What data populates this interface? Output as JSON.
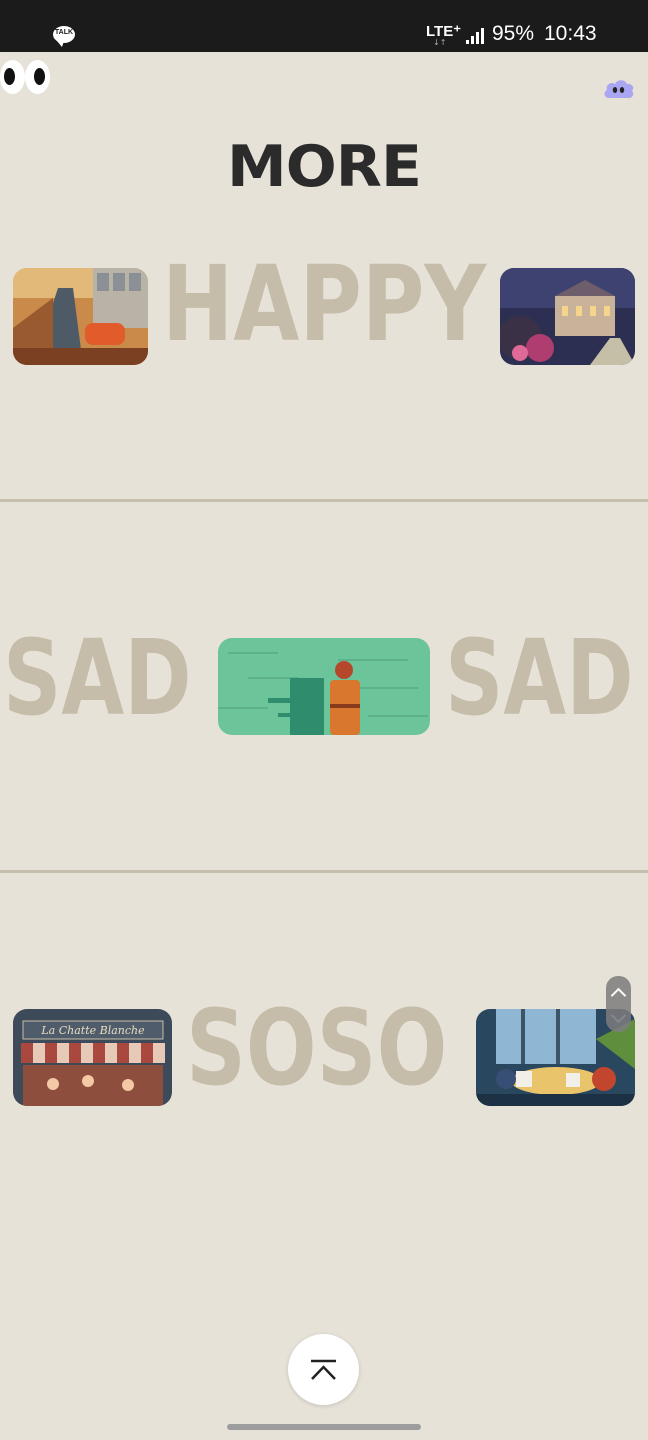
{
  "status_bar": {
    "app_badge": "TALK",
    "network": "LTE⁺",
    "battery": "95%",
    "time": "10:43"
  },
  "header": {
    "title": "MORE"
  },
  "sections": [
    {
      "word": "HAPPY",
      "images": [
        "rainy-street-illustration",
        "night-palace-garden-illustration"
      ]
    },
    {
      "word_left": "SAD",
      "word_right": "SAD",
      "images": [
        "woman-on-green-sea-illustration"
      ]
    },
    {
      "word": "SOSO",
      "images": [
        "la-chatte-blanche-shopfront-illustration",
        "cafe-window-illustration"
      ]
    }
  ],
  "shopfront_sign": "La Chatte Blanche",
  "colors": {
    "background": "#e7e2d8",
    "word": "#c5bca9",
    "title": "#2b2b2b",
    "divider": "#c6bfae",
    "cloud_icon": "#a9a6f2"
  },
  "icons": [
    "talk-icon",
    "eyes-icon",
    "cloud-icon",
    "chevron-up-icon"
  ]
}
